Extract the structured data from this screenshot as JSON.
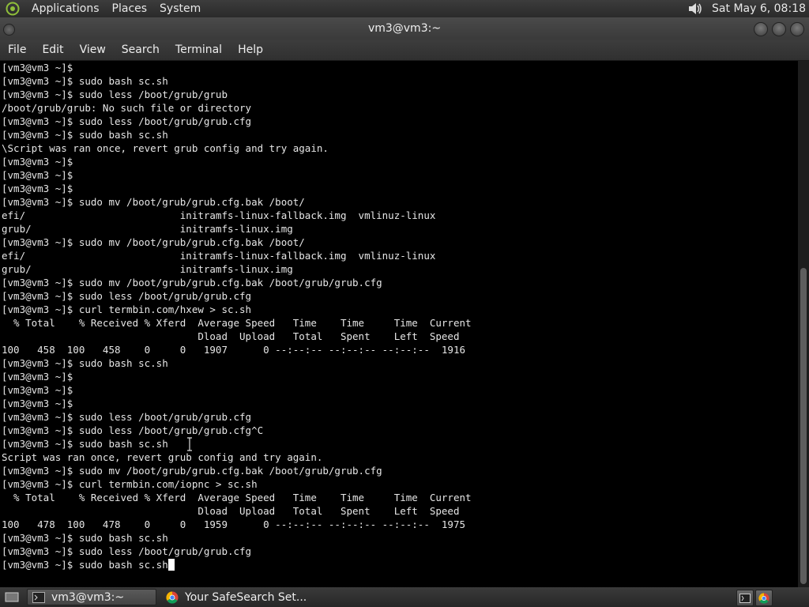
{
  "top_panel": {
    "menus": [
      "Applications",
      "Places",
      "System"
    ],
    "clock": "Sat May  6, 08:18"
  },
  "window": {
    "title": "vm3@vm3:~"
  },
  "menubar": {
    "items": [
      "File",
      "Edit",
      "View",
      "Search",
      "Terminal",
      "Help"
    ]
  },
  "terminal": {
    "lines": [
      "[vm3@vm3 ~]$",
      "[vm3@vm3 ~]$ sudo bash sc.sh",
      "[vm3@vm3 ~]$ sudo less /boot/grub/grub",
      "/boot/grub/grub: No such file or directory",
      "[vm3@vm3 ~]$ sudo less /boot/grub/grub.cfg",
      "[vm3@vm3 ~]$ sudo bash sc.sh",
      "\\Script was ran once, revert grub config and try again.",
      "[vm3@vm3 ~]$",
      "[vm3@vm3 ~]$",
      "[vm3@vm3 ~]$",
      "[vm3@vm3 ~]$ sudo mv /boot/grub/grub.cfg.bak /boot/",
      "efi/                          initramfs-linux-fallback.img  vmlinuz-linux",
      "grub/                         initramfs-linux.img",
      "[vm3@vm3 ~]$ sudo mv /boot/grub/grub.cfg.bak /boot/",
      "efi/                          initramfs-linux-fallback.img  vmlinuz-linux",
      "grub/                         initramfs-linux.img",
      "[vm3@vm3 ~]$ sudo mv /boot/grub/grub.cfg.bak /boot/grub/grub.cfg",
      "[vm3@vm3 ~]$ sudo less /boot/grub/grub.cfg",
      "[vm3@vm3 ~]$ curl termbin.com/hxew > sc.sh",
      "  % Total    % Received % Xferd  Average Speed   Time    Time     Time  Current",
      "                                 Dload  Upload   Total   Spent    Left  Speed",
      "100   458  100   458    0     0   1907      0 --:--:-- --:--:-- --:--:--  1916",
      "[vm3@vm3 ~]$ sudo bash sc.sh",
      "[vm3@vm3 ~]$",
      "[vm3@vm3 ~]$",
      "[vm3@vm3 ~]$",
      "[vm3@vm3 ~]$ sudo less /boot/grub/grub.cfg",
      "[vm3@vm3 ~]$ sudo less /boot/grub/grub.cfg^C",
      "[vm3@vm3 ~]$ sudo bash sc.sh",
      "Script was ran once, revert grub config and try again.",
      "[vm3@vm3 ~]$ sudo mv /boot/grub/grub.cfg.bak /boot/grub/grub.cfg",
      "[vm3@vm3 ~]$ curl termbin.com/iopnc > sc.sh",
      "  % Total    % Received % Xferd  Average Speed   Time    Time     Time  Current",
      "                                 Dload  Upload   Total   Spent    Left  Speed",
      "100   478  100   478    0     0   1959      0 --:--:-- --:--:-- --:--:--  1975",
      "[vm3@vm3 ~]$ sudo bash sc.sh",
      "[vm3@vm3 ~]$ sudo less /boot/grub/grub.cfg"
    ],
    "current_line": "[vm3@vm3 ~]$ sudo bash sc.sh"
  },
  "taskbar": {
    "tasks": [
      {
        "label": "vm3@vm3:~",
        "icon": "terminal-icon",
        "active": true
      },
      {
        "label": "Your SafeSearch Set...",
        "icon": "chrome-icon",
        "active": false
      }
    ]
  },
  "colors": {
    "terminal_bg": "#000000",
    "terminal_fg": "#e6e6e6",
    "panel_bg": "#2f2f2f"
  }
}
